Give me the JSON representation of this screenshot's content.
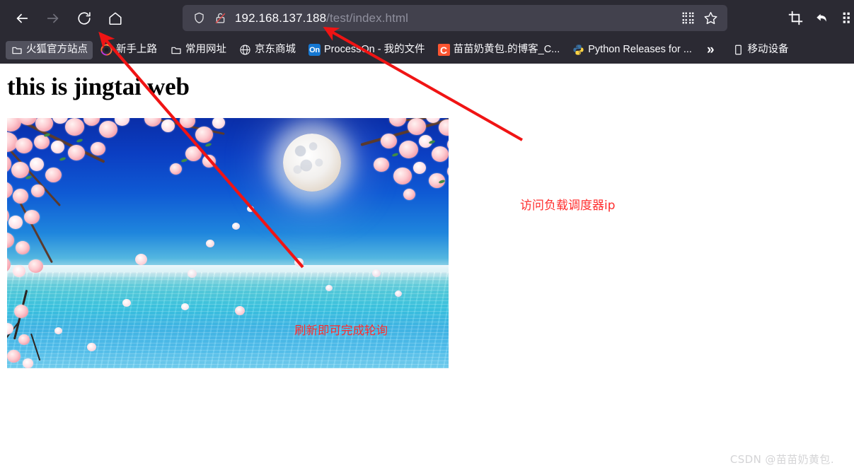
{
  "browser": {
    "nav": {
      "back": "back-arrow",
      "forward": "forward-arrow",
      "reload": "reload",
      "home": "home"
    },
    "urlbar": {
      "shield_icon": "shield-icon",
      "lock_icon": "broken-lock-icon",
      "url_domain": "192.168.137.188",
      "url_path": "/test/index.html",
      "qr_icon": "qr-code-icon",
      "bookmark_icon": "star-icon"
    },
    "toolbar_right": {
      "crop_label": "crop-icon",
      "undo_label": "undo-icon",
      "extension_label": "extension-icon"
    },
    "bookmarks": [
      {
        "label": "火狐官方站点",
        "icon": "folder-icon",
        "active": true
      },
      {
        "label": "新手上路",
        "icon": "firefox-icon",
        "active": false
      },
      {
        "label": "常用网址",
        "icon": "folder-icon",
        "active": false
      },
      {
        "label": "京东商城",
        "icon": "globe-icon",
        "active": false
      },
      {
        "label": "ProcessOn - 我的文件",
        "icon": "processon-icon",
        "active": false
      },
      {
        "label": "苗苗奶黄包.的博客_C...",
        "icon": "csdn-icon",
        "active": false
      },
      {
        "label": "Python Releases for ...",
        "icon": "python-icon",
        "active": false
      }
    ],
    "overflow_chevron": "»",
    "mobile_bookmark": {
      "label": "移动设备",
      "icon": "mobile-device-icon"
    }
  },
  "page": {
    "heading": "this is jingtai web",
    "image_alt": "cherry-blossom-moon-sea"
  },
  "annotations": [
    {
      "text": "访问负载调度器ip",
      "target": "url-bar"
    },
    {
      "text": "刷新即可完成轮询",
      "target": "reload-button"
    }
  ],
  "watermark": "CSDN @苗苗奶黄包.",
  "colors": {
    "chrome_bg": "#2b2a33",
    "urlbar_bg": "#42414d",
    "annotation_red": "#ff2d2d",
    "url_text": "#fbfbfe",
    "url_path": "#8f8f9d"
  }
}
